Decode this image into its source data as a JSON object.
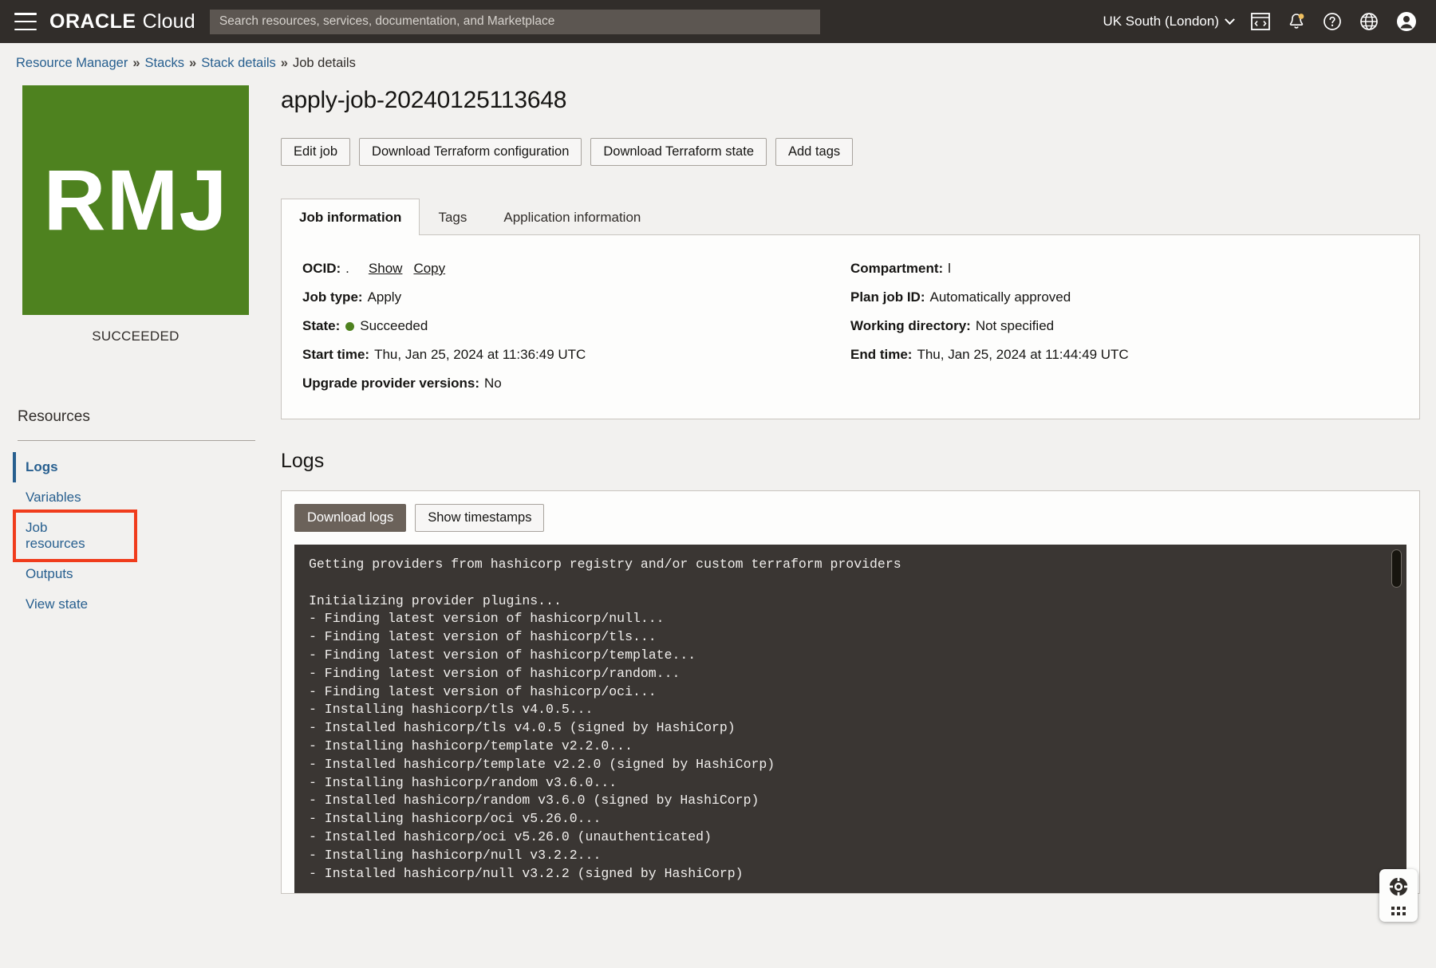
{
  "topbar": {
    "menu_icon": "hamburger-menu-icon",
    "brand_oracle": "ORACLE",
    "brand_cloud": "Cloud",
    "search_placeholder": "Search resources, services, documentation, and Marketplace",
    "search_value": "",
    "region": "UK South (London)",
    "icons": [
      "cloud-shell-icon",
      "notifications-bell-icon",
      "help-icon",
      "language-globe-icon",
      "user-profile-icon"
    ],
    "notification_badge_color": "#f0c060",
    "background_color": "#312d2a"
  },
  "breadcrumb": {
    "items": [
      {
        "label": "Resource Manager",
        "link": true
      },
      {
        "label": "Stacks",
        "link": true
      },
      {
        "label": "Stack details",
        "link": true
      },
      {
        "label": "Job details",
        "link": false
      }
    ],
    "separator": "»"
  },
  "sidebar": {
    "avatar_initials": "RMJ",
    "avatar_color": "#4e821f",
    "avatar_status": "SUCCEEDED",
    "resources_title": "Resources",
    "items": [
      {
        "label": "Logs",
        "active": true,
        "annotated": false
      },
      {
        "label": "Variables",
        "active": false,
        "annotated": false
      },
      {
        "label": "Job resources",
        "active": false,
        "annotated": true
      },
      {
        "label": "Outputs",
        "active": false,
        "annotated": false
      },
      {
        "label": "View state",
        "active": false,
        "annotated": false
      }
    ],
    "annotation_color": "#f03c1c"
  },
  "main": {
    "title": "apply-job-20240125113648",
    "actions": [
      "Edit job",
      "Download Terraform configuration",
      "Download Terraform state",
      "Add tags"
    ],
    "tabs": [
      {
        "label": "Job information",
        "active": true
      },
      {
        "label": "Tags",
        "active": false
      },
      {
        "label": "Application information",
        "active": false
      }
    ],
    "details_left": [
      {
        "label": "OCID:",
        "value": ".",
        "links": [
          "Show",
          "Copy"
        ]
      },
      {
        "label": "Job type:",
        "value": "Apply"
      },
      {
        "label": "State:",
        "value": "Succeeded",
        "status_dot": "#4e821f"
      },
      {
        "label": "Start time:",
        "value": "Thu, Jan 25, 2024 at 11:36:49 UTC"
      },
      {
        "label": "Upgrade provider versions:",
        "value": "No"
      }
    ],
    "details_right": [
      {
        "label": "Compartment:",
        "value": "l"
      },
      {
        "label": "Plan job ID:",
        "value": "Automatically approved"
      },
      {
        "label": "Working directory:",
        "value": "Not specified"
      },
      {
        "label": "End time:",
        "value": "Thu, Jan 25, 2024 at 11:44:49 UTC"
      }
    ]
  },
  "logs": {
    "heading": "Logs",
    "download_button": "Download logs",
    "timestamps_button": "Show timestamps",
    "console_background": "#3a3633",
    "content": "Getting providers from hashicorp registry and/or custom terraform providers\n\nInitializing provider plugins...\n- Finding latest version of hashicorp/null...\n- Finding latest version of hashicorp/tls...\n- Finding latest version of hashicorp/template...\n- Finding latest version of hashicorp/random...\n- Finding latest version of hashicorp/oci...\n- Installing hashicorp/tls v4.0.5...\n- Installed hashicorp/tls v4.0.5 (signed by HashiCorp)\n- Installing hashicorp/template v2.2.0...\n- Installed hashicorp/template v2.2.0 (signed by HashiCorp)\n- Installing hashicorp/random v3.6.0...\n- Installed hashicorp/random v3.6.0 (signed by HashiCorp)\n- Installing hashicorp/oci v5.26.0...\n- Installed hashicorp/oci v5.26.0 (unauthenticated)\n- Installing hashicorp/null v3.2.2...\n- Installed hashicorp/null v3.2.2 (signed by HashiCorp)\n\nTerraform has created a lock file .terraform.lock.hcl to record the provider"
  },
  "support_widget": {
    "icon": "life-ring-support-icon",
    "grid_icon": "app-grid-icon"
  }
}
